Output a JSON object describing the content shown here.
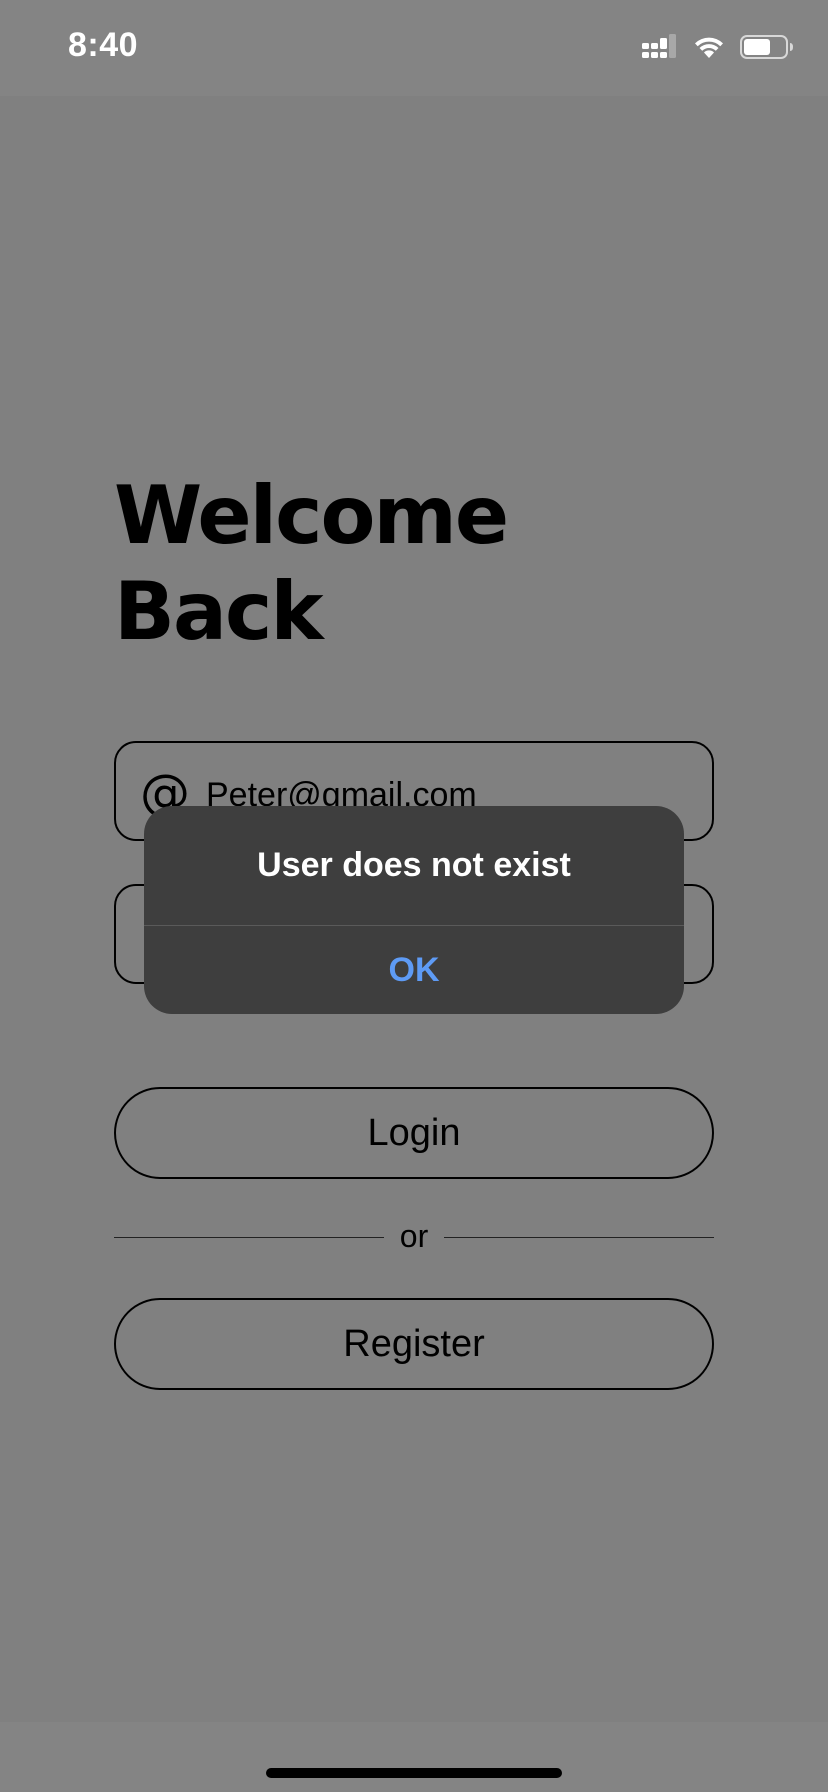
{
  "status_bar": {
    "time": "8:40",
    "icons": [
      "cellular-signal-icon",
      "wifi-icon",
      "battery-icon"
    ]
  },
  "login": {
    "title_line1": "Welcome",
    "title_line2": "Back",
    "email_icon": "at-icon",
    "email_value": "Peter@gmail.com",
    "login_label": "Login",
    "divider_text": "or",
    "register_label": "Register"
  },
  "alert": {
    "title": "User does not exist",
    "ok_label": "OK"
  },
  "colors": {
    "overlay": "#808080",
    "alert_bg": "#3e3e3e",
    "accent": "#5e9bf5"
  }
}
